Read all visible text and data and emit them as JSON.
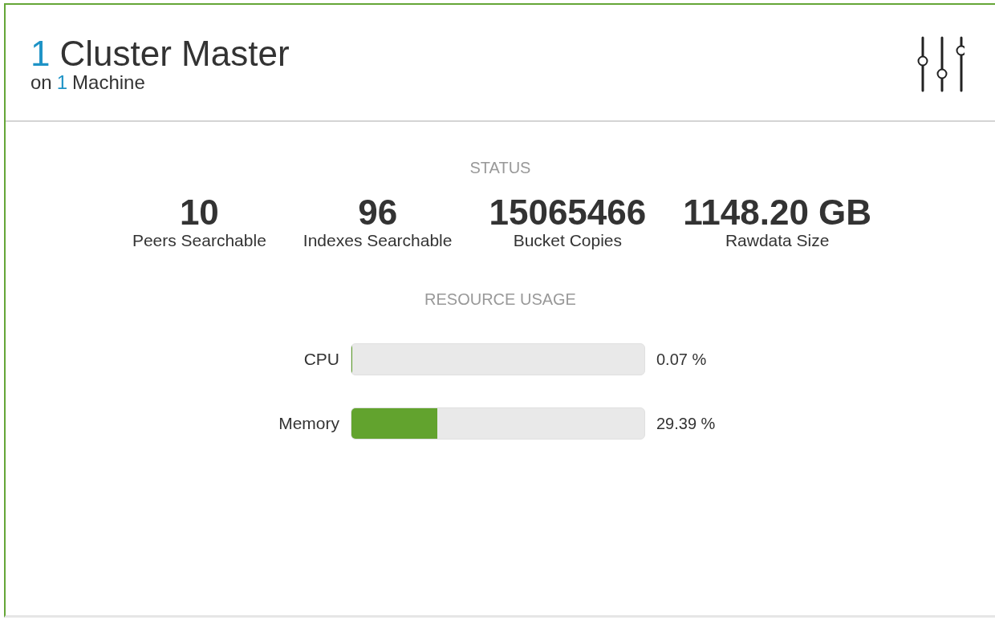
{
  "header": {
    "count": "1",
    "title": "Cluster Master",
    "subtitle_prefix": "on",
    "subtitle_count": "1",
    "subtitle_suffix": "Machine"
  },
  "status": {
    "heading": "STATUS",
    "stats": [
      {
        "value": "10",
        "label": "Peers Searchable"
      },
      {
        "value": "96",
        "label": "Indexes Searchable"
      },
      {
        "value": "15065466",
        "label": "Bucket Copies"
      },
      {
        "value": "1148.20 GB",
        "label": "Rawdata Size"
      }
    ]
  },
  "resource_usage": {
    "heading": "RESOURCE USAGE",
    "meters": [
      {
        "name": "CPU",
        "level": 0.0007,
        "reading": "0.07 %"
      },
      {
        "name": "Memory",
        "level": 0.2939,
        "reading": "29.39 %"
      }
    ]
  }
}
